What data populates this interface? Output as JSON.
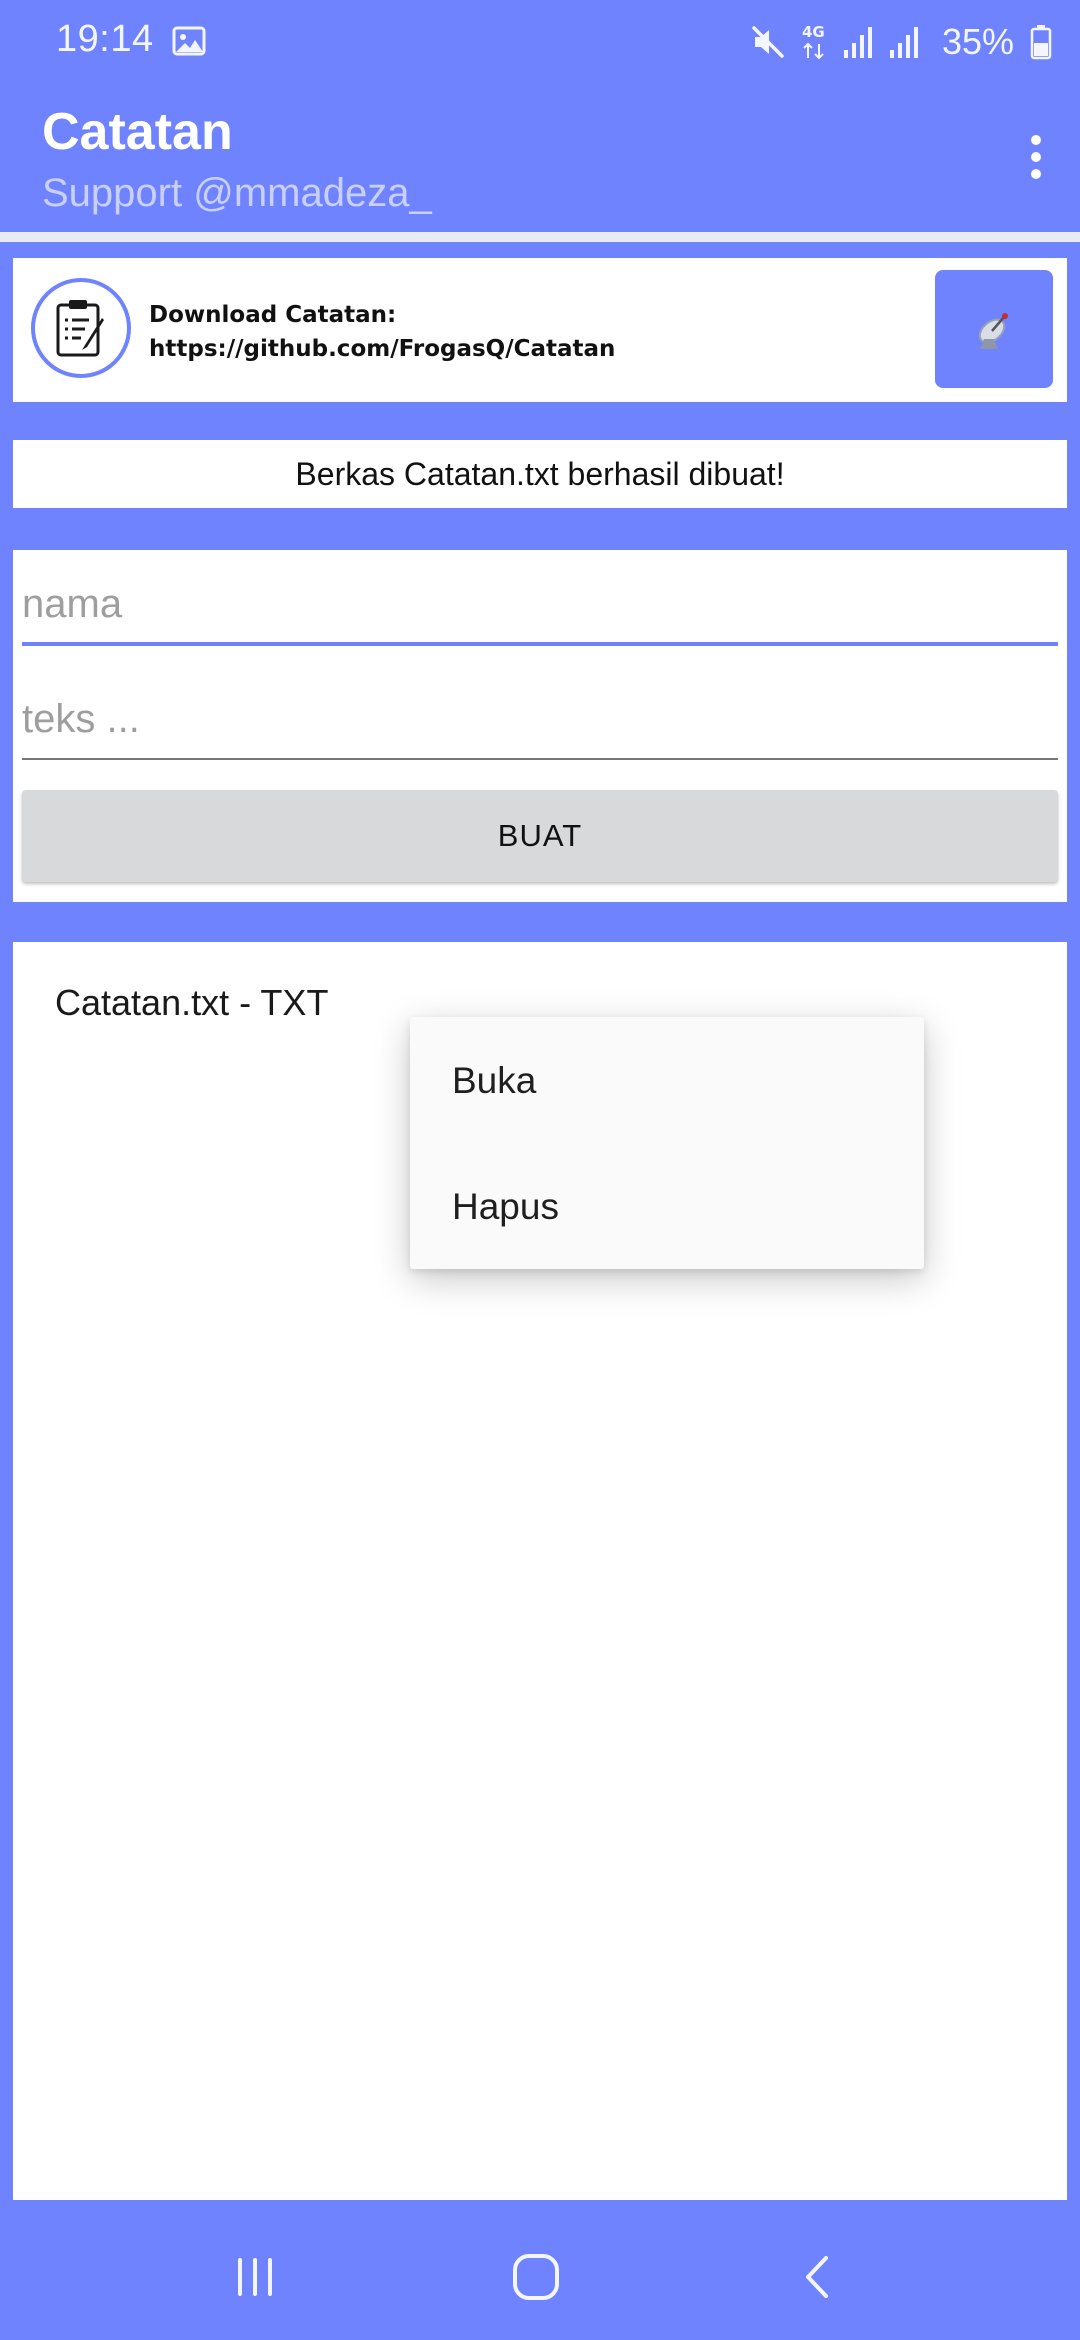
{
  "colors": {
    "primary": "#6f83ff",
    "subtitle": "#c8d0ff",
    "card_background": "#ffffff",
    "button_background": "#d7d9da",
    "menu_background": "#fafafa"
  },
  "status_bar": {
    "time": "19:14",
    "battery_percent": "35%",
    "icons": [
      "gallery-icon",
      "mute-icon",
      "4g-icon",
      "signal-icon",
      "signal-icon",
      "battery-icon"
    ]
  },
  "app_bar": {
    "title": "Catatan",
    "subtitle": "Support @mmadeza_",
    "menu_icon": "more-vert-icon"
  },
  "banner": {
    "line1": "Download Catatan:",
    "line2": "https://github.com/FrogasQ/Catatan",
    "logo_icon": "notepad-icon",
    "button_icon": "satellite-dish-icon"
  },
  "message": {
    "text": "Berkas Catatan.txt berhasil dibuat!"
  },
  "form": {
    "name_placeholder": "nama",
    "text_placeholder": "teks ...",
    "create_button": "BUAT"
  },
  "file_list": {
    "items": [
      {
        "label": "Catatan.txt - TXT"
      }
    ]
  },
  "popup_menu": {
    "items": [
      {
        "label": "Buka"
      },
      {
        "label": "Hapus"
      }
    ]
  },
  "nav_bar": {
    "icons": [
      "recent-apps-icon",
      "home-icon",
      "back-icon"
    ]
  }
}
